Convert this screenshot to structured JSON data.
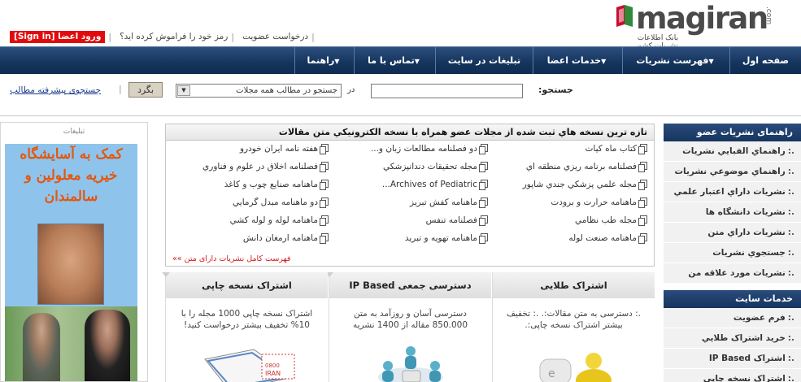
{
  "header": {
    "logo_text": "magiran",
    "logo_suffix": ".com",
    "tagline": "بانک اطلاعات نشریات کشور",
    "signin_label": "ورود اعضا [Sign in]",
    "forgot_password": "رمز خود را فراموش کرده اید؟",
    "membership_request": "درخواست عضویت"
  },
  "nav": {
    "items": [
      "صفحه اول",
      "فهرست نشریات",
      "خدمات اعضا",
      "تبلیغات در سایت",
      "تماس با ما",
      "راهنما"
    ]
  },
  "search": {
    "label": "جستجو:",
    "input_value": "",
    "in_label": "در",
    "scope_value": "جستجو در مطالب همه مجلات",
    "go_label": "بگرد",
    "advanced_label": "جستجوی پیشرفته مطالب"
  },
  "ads": {
    "title": "تبلیغات",
    "ad1_text": "کمک به آسایشگاه خیریه معلولین و سالمندان"
  },
  "featured": {
    "title": "تازه ترین نسخه هاي ثبت شده از مجلات عضو همراه با نسخه الکترونیکي متن مقالات",
    "columns": [
      [
        "کتاب ماه کیات",
        "فصلنامه برنامه ريزي منطقه اي",
        "مجله علمي پزشكي جندي شاپور",
        "ماهنامه حرارت و برودت",
        "مجله طب نظامي",
        "ماهنامه صنعت لوله"
      ],
      [
        "دو فصلنامه مطالعات زبان و...",
        "مجله تحقیقات دندانپزشکي",
        "Archives of Pediatric...",
        "ماهنامه كفش تبريز",
        "فصلنامه تنفس",
        "ماهنامه تهويه و تبريد"
      ],
      [
        "هفته نامه ایران خودرو",
        "فصلنامه اخلاق در علوم و فناوري",
        "ماهنامه صنايع چوب و كاغذ",
        "دو ماهنامه مبدل گرمايي",
        "ماهنامه لوله و لوله كشي",
        "ماهنامه ارمغان دانش"
      ]
    ],
    "full_list_label": "فهرست کامل نشریات دارای متن »»"
  },
  "services": [
    {
      "title": "اشتراک طلایی",
      "desc": ".: دسترسی به متن مقالات:. .: تخفیف بیشتر اشتراک نسخه چاپی:."
    },
    {
      "title": "دسترسی جمعی IP Based",
      "desc": "دسترسی آسان و روزآمد به متن 850.000 مقاله از 1400 نشریه"
    },
    {
      "title": "اشتراک نسخه چاپی",
      "desc": "اشتراک نسخه چاپی 1000 مجله را با 10% تخفیف بیشتر درخواست کنید!"
    }
  ],
  "sidebar": {
    "section1_title": "راهنمای نشریات عضو",
    "section1_items": [
      "راهنماي الفبايي نشريات",
      "راهنماي موضوعي نشريات",
      "نشريات داراي اعتبار علمي",
      "نشريات دانشگاه ها",
      "نشريات داراي متن",
      "جستجوي نشريات",
      "نشريات مورد علاقه من"
    ],
    "section2_title": "خدمات سایت",
    "section2_items": [
      "فرم عضويت",
      "خريد اشتراک طلايي",
      "اشتراک IP Based",
      "اشتراک نسخه چاپي"
    ]
  },
  "colors": {
    "nav_bg": "#16365f",
    "signin_bg": "#e10b0b",
    "logo_red": "#c8102e",
    "logo_green": "#2e8b3a"
  }
}
